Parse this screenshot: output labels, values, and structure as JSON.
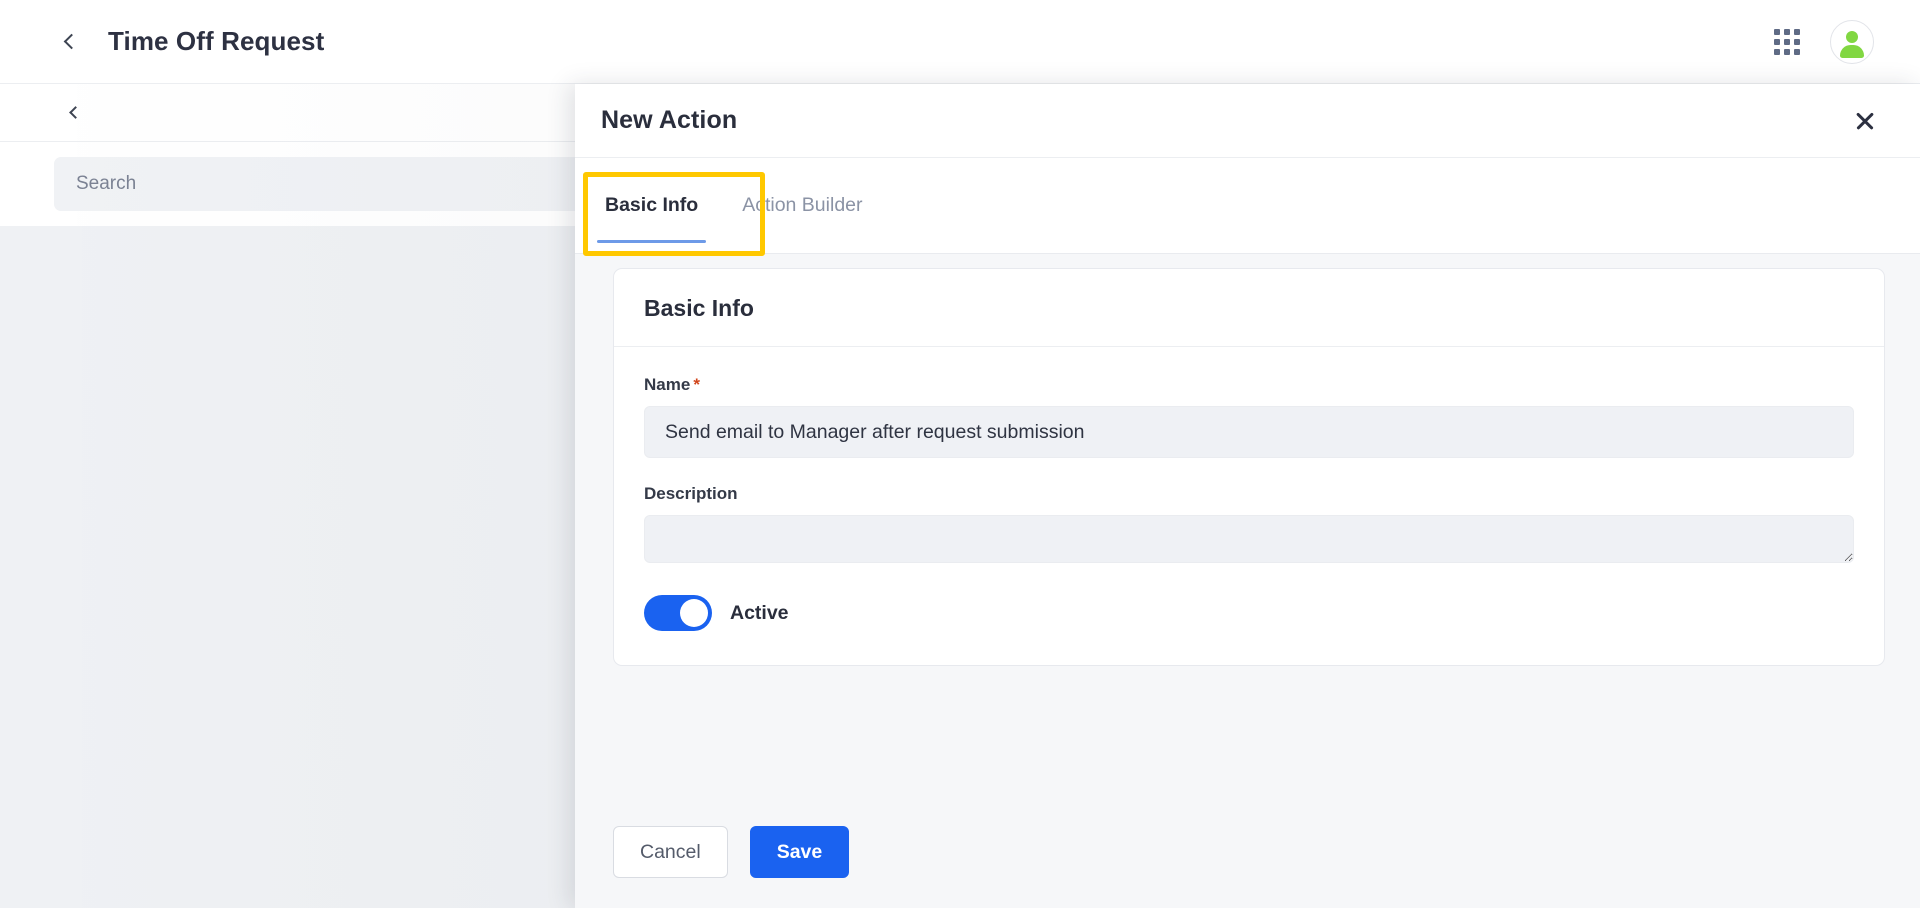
{
  "app": {
    "header": {
      "back_icon": "chevron-left-icon",
      "title": "Time Off Request",
      "apps_icon": "grid-apps-icon",
      "avatar_icon": "user-avatar-icon"
    },
    "subbar": {
      "back_icon": "chevron-left-icon"
    },
    "search": {
      "placeholder": "Search",
      "value": ""
    }
  },
  "modal": {
    "title": "New Action",
    "close_icon": "close-x-icon",
    "tabs": [
      {
        "label": "Basic Info",
        "active": true,
        "highlighted": true
      },
      {
        "label": "Action Builder",
        "active": false,
        "highlighted": false
      }
    ],
    "card": {
      "heading": "Basic Info",
      "fields": {
        "name": {
          "label": "Name",
          "required_marker": "*",
          "value": "Send email to Manager after request submission",
          "placeholder": ""
        },
        "description": {
          "label": "Description",
          "value": "",
          "placeholder": ""
        },
        "active_toggle": {
          "label": "Active",
          "state": "on"
        }
      }
    },
    "footer": {
      "cancel_label": "Cancel",
      "save_label": "Save"
    }
  },
  "colors": {
    "primary_blue": "#1a62f0",
    "tab_underline": "#6d9ae8",
    "highlight_yellow": "#ffc800",
    "required_asterisk": "#d1451b",
    "avatar_green": "#81d742",
    "panel_bg": "#f6f7f9",
    "app_bg": "#eff1f4"
  }
}
